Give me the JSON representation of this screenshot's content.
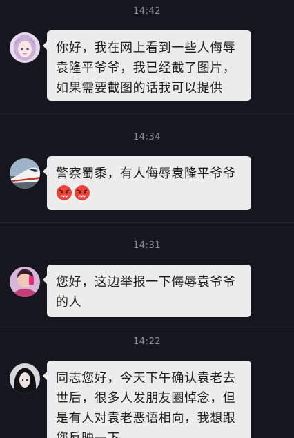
{
  "messages": [
    {
      "time": "14:42",
      "lines": [
        "你好，我在网上看到一些人侮辱",
        "袁隆平爷爷，我已经截了图片，",
        "如果需要截图的话我可以提供"
      ],
      "avatar_icon": "avatar-anime-girl-icon"
    },
    {
      "time": "14:34",
      "lines": [
        "警察蜀黍，有人侮辱袁隆平爷爷"
      ],
      "emojis": [
        "angry-face-icon",
        "angry-face-icon"
      ],
      "avatar_icon": "avatar-train-icon"
    },
    {
      "time": "14:31",
      "lines": [
        "您好，这边举报一下侮辱袁爷爷",
        "的人"
      ],
      "avatar_icon": "avatar-person-icon"
    },
    {
      "time": "14:22",
      "lines": [
        "同志您好，今天下午确认袁老去",
        "世后，很多人发朋友圈悼念，但",
        "是有人对袁老恶语相向，我想跟",
        "您反映一下"
      ],
      "avatar_icon": "avatar-dark-hair-icon"
    }
  ],
  "colors": {
    "background": "#16161e",
    "bubble": "#ececec",
    "time_text": "#8e8e96",
    "angry_emoji": "#e8453c"
  }
}
